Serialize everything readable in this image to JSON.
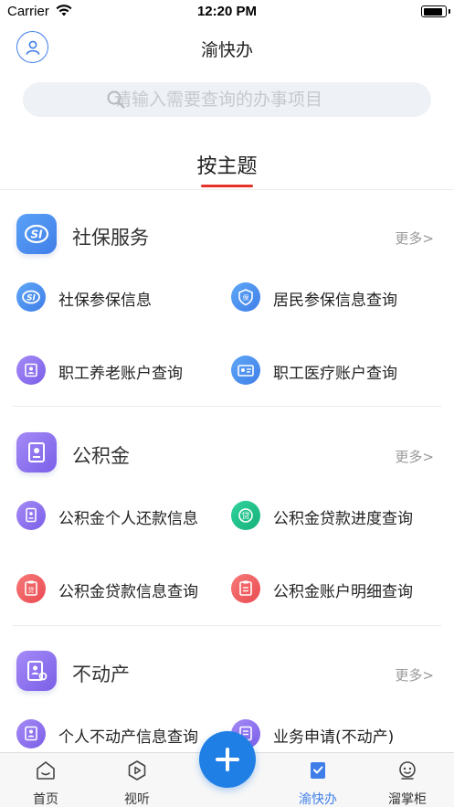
{
  "status": {
    "carrier": "Carrier",
    "time": "12:20 PM",
    "battery_level": 0.9
  },
  "nav": {
    "title": "渝快办"
  },
  "search": {
    "placeholder": "请输入需要查询的办事项目"
  },
  "tabs": {
    "active_label": "按主题"
  },
  "sections": [
    {
      "title": "社保服务",
      "more": "更多>",
      "items": [
        {
          "label": "社保参保信息",
          "icon": "social-insurance-icon"
        },
        {
          "label": "居民参保信息查询",
          "icon": "shield-icon"
        },
        {
          "label": "职工养老账户查询",
          "icon": "pension-account-icon"
        },
        {
          "label": "职工医疗账户查询",
          "icon": "medical-card-icon"
        }
      ]
    },
    {
      "title": "公积金",
      "more": "更多>",
      "items": [
        {
          "label": "公积金个人还款信息",
          "icon": "repayment-doc-icon"
        },
        {
          "label": "公积金贷款进度查询",
          "icon": "loan-progress-icon"
        },
        {
          "label": "公积金贷款信息查询",
          "icon": "loan-info-icon"
        },
        {
          "label": "公积金账户明细查询",
          "icon": "account-detail-icon"
        }
      ]
    },
    {
      "title": "不动产",
      "more": "更多>",
      "items": [
        {
          "label": "个人不动产信息查询",
          "icon": "property-info-icon"
        },
        {
          "label": "业务申请(不动产)",
          "icon": "business-application-icon"
        }
      ]
    }
  ],
  "tabbar": {
    "items": [
      {
        "label": "首页",
        "icon": "home-icon"
      },
      {
        "label": "视听",
        "icon": "play-icon"
      },
      {
        "label": "渝快办",
        "icon": "checklist-icon"
      },
      {
        "label": "溜掌柜",
        "icon": "robot-icon"
      }
    ],
    "active": "渝快办",
    "fab_icon": "plus-icon"
  },
  "colors": {
    "accent": "#3f7ee8",
    "tab_underline": "#e5332a",
    "fab": "#1f7fe5",
    "social_blue": "#4a8cf0",
    "purple": "#8b6ef0",
    "green": "#1dbf88",
    "red": "#f0565a"
  }
}
